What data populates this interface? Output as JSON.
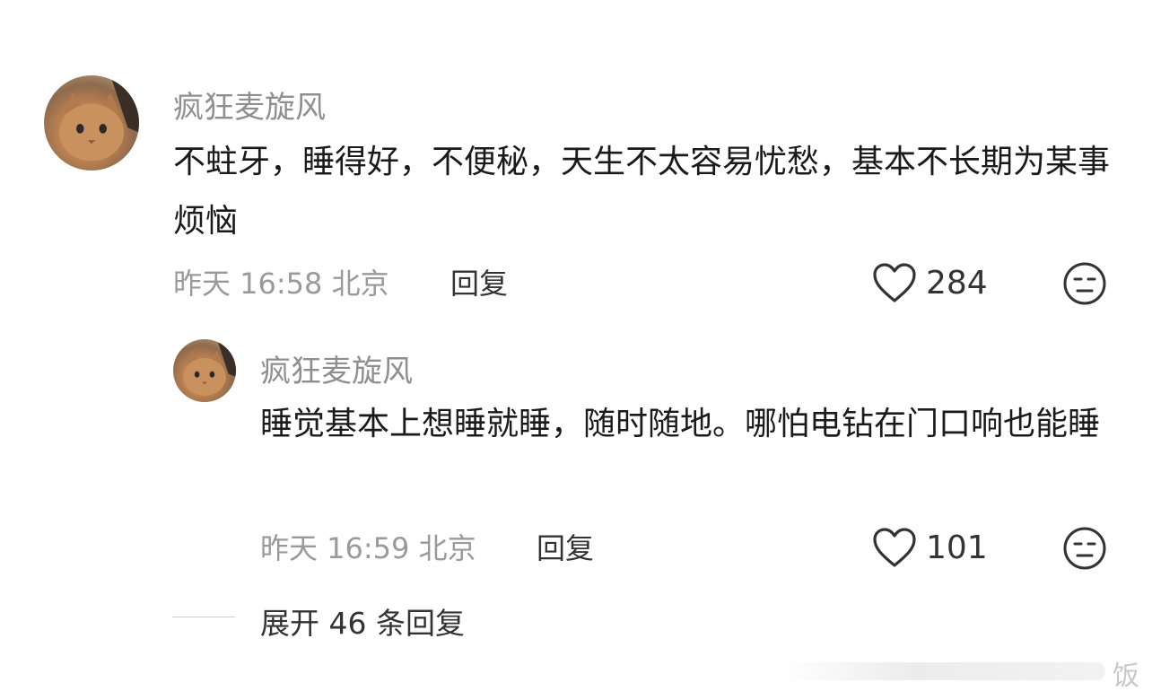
{
  "comments": [
    {
      "username": "疯狂麦旋风",
      "text": "不蛀牙，睡得好，不便秘，天生不太容易忧愁，基本不长期为某事烦恼",
      "meta": "昨天 16:58 北京",
      "reply_label": "回复",
      "likes": "284"
    },
    {
      "username": "疯狂麦旋风",
      "text": "睡觉基本上想睡就睡，随时随地。哪怕电钻在门口响也能睡",
      "meta": "昨天 16:59 北京",
      "reply_label": "回复",
      "likes": "101"
    }
  ],
  "expand_label": "展开 46 条回复",
  "watermark": "饭",
  "icons": {
    "like": "heart-outline-icon",
    "reaction": "neutral-face-icon",
    "avatar": "cat-avatar"
  },
  "colors": {
    "username": "#8f8f8f",
    "text": "#1a1a1a",
    "meta": "#9a9a9a"
  }
}
